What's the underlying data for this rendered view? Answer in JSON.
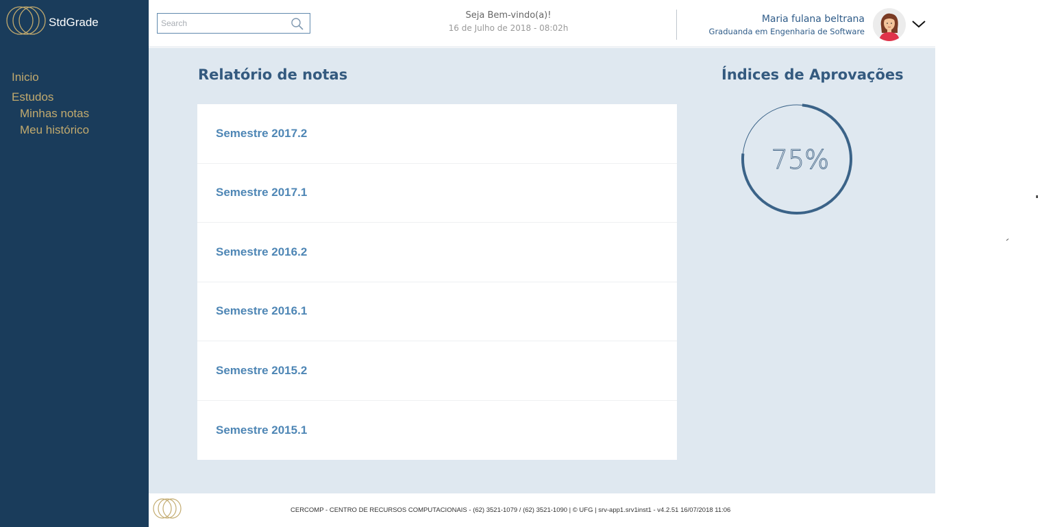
{
  "brand": {
    "name": "StdGrade",
    "logo_icon": "interlocking-rings-logo",
    "logo_color": "#c2aa6e"
  },
  "sidebar": {
    "background": "#1a3c5b",
    "items": [
      {
        "label": "Inicio"
      },
      {
        "label": "Estudos",
        "children": [
          {
            "label": "Minhas notas"
          },
          {
            "label": "Meu histórico"
          }
        ]
      }
    ]
  },
  "header": {
    "search": {
      "placeholder": "Search",
      "value": "",
      "icon": "search-icon"
    },
    "welcome": {
      "title": "Seja Bem-vindo(a)!",
      "date": "16 de Julho de 2018 - 08:02h"
    },
    "user": {
      "name": "Maria fulana beltrana",
      "role": "Graduanda em Engenharia de Software",
      "avatar_icon": "female-avatar-icon",
      "menu_icon": "chevron-down-icon"
    }
  },
  "main": {
    "report": {
      "title": "Relatório de notas",
      "semesters": [
        {
          "label": "Semestre 2017.2"
        },
        {
          "label": "Semestre 2017.1"
        },
        {
          "label": "Semestre 2016.2"
        },
        {
          "label": "Semestre 2016.1"
        },
        {
          "label": "Semestre 2015.2"
        },
        {
          "label": "Semestre 2015.1"
        }
      ]
    },
    "approval": {
      "title": "Índices de Aprovações",
      "value_label": "75%",
      "percent": 75,
      "ring_color": "#3b6388"
    }
  },
  "footer": {
    "text": "CERCOMP - CENTRO DE RECURSOS COMPUTACIONAIS - (62) 3521-1079 / (62) 3521-1090 | © UFG | srv-app1.srv1inst1 - v4.2.51 16/07/2018 11:06",
    "logo_icon": "interlocking-rings-logo"
  },
  "colors": {
    "accent": "#c2aa6e",
    "primary": "#1a3c5b",
    "link": "#4e86b5",
    "content_bg": "#dfe8f0"
  }
}
